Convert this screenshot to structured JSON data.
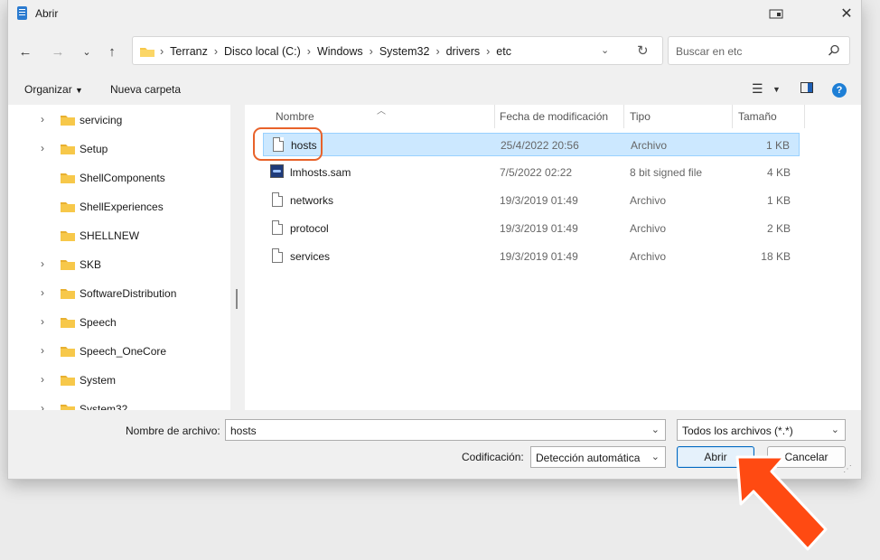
{
  "window": {
    "title": "Abrir"
  },
  "nav": {
    "breadcrumbs": [
      "Terranz",
      "Disco local (C:)",
      "Windows",
      "System32",
      "drivers",
      "etc"
    ],
    "search_placeholder": "Buscar en etc"
  },
  "toolbar": {
    "organize": "Organizar",
    "new_folder": "Nueva carpeta"
  },
  "tree": {
    "items": [
      {
        "label": "servicing",
        "expandable": true
      },
      {
        "label": "Setup",
        "expandable": true
      },
      {
        "label": "ShellComponents",
        "expandable": false
      },
      {
        "label": "ShellExperiences",
        "expandable": false
      },
      {
        "label": "SHELLNEW",
        "expandable": false
      },
      {
        "label": "SKB",
        "expandable": true
      },
      {
        "label": "SoftwareDistribution",
        "expandable": true
      },
      {
        "label": "Speech",
        "expandable": true
      },
      {
        "label": "Speech_OneCore",
        "expandable": true
      },
      {
        "label": "System",
        "expandable": true
      },
      {
        "label": "System32",
        "expandable": true
      }
    ]
  },
  "files": {
    "columns": {
      "name": "Nombre",
      "date": "Fecha de modificación",
      "type": "Tipo",
      "size": "Tamaño"
    },
    "rows": [
      {
        "name": "hosts",
        "date": "25/4/2022 20:56",
        "type": "Archivo",
        "size": "1 KB",
        "selected": true,
        "icon": "file-icon"
      },
      {
        "name": "lmhosts.sam",
        "date": "7/5/2022 02:22",
        "type": "8 bit signed file",
        "size": "4 KB",
        "selected": false,
        "icon": "sam-file-icon"
      },
      {
        "name": "networks",
        "date": "19/3/2019 01:49",
        "type": "Archivo",
        "size": "1 KB",
        "selected": false,
        "icon": "file-icon"
      },
      {
        "name": "protocol",
        "date": "19/3/2019 01:49",
        "type": "Archivo",
        "size": "2 KB",
        "selected": false,
        "icon": "file-icon"
      },
      {
        "name": "services",
        "date": "19/3/2019 01:49",
        "type": "Archivo",
        "size": "18 KB",
        "selected": false,
        "icon": "file-icon"
      }
    ]
  },
  "bottom": {
    "filename_label": "Nombre de archivo:",
    "filename_value": "hosts",
    "filter_value": "Todos los archivos  (*.*)",
    "encoding_label": "Codificación:",
    "encoding_value": "Detección automática",
    "open_label": "Abrir",
    "cancel_label": "Cancelar"
  },
  "colors": {
    "accent": "#0067c0",
    "selection": "#cce8ff",
    "annotation": "#ff4a12",
    "folder": "#f7c84a"
  }
}
